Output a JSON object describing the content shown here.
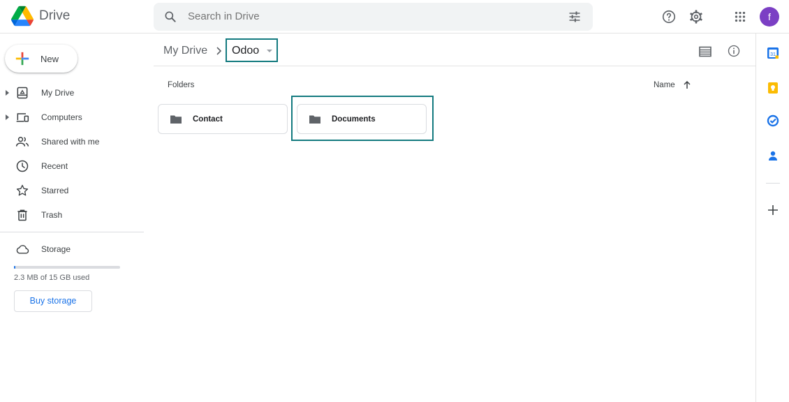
{
  "app": {
    "title": "Drive"
  },
  "search": {
    "placeholder": "Search in Drive"
  },
  "header": {
    "avatar_letter": "f",
    "avatar_color": "#7b3fc4"
  },
  "new_button": {
    "label": "New"
  },
  "sidebar": {
    "items": [
      {
        "label": "My Drive",
        "icon": "my-drive-icon",
        "expandable": true
      },
      {
        "label": "Computers",
        "icon": "computers-icon",
        "expandable": true
      },
      {
        "label": "Shared with me",
        "icon": "shared-with-me-icon",
        "expandable": false
      },
      {
        "label": "Recent",
        "icon": "clock-icon",
        "expandable": false
      },
      {
        "label": "Starred",
        "icon": "star-icon",
        "expandable": false
      },
      {
        "label": "Trash",
        "icon": "trash-icon",
        "expandable": false
      }
    ],
    "storage": {
      "label": "Storage",
      "used_text": "2.3 MB of 15 GB used",
      "used_fraction": 0.0002,
      "buy_label": "Buy storage"
    }
  },
  "breadcrumb": {
    "root": "My Drive",
    "current": "Odoo"
  },
  "main": {
    "section_title": "Folders",
    "sort_label": "Name",
    "folders": [
      {
        "name": "Contact"
      },
      {
        "name": "Documents",
        "highlighted": true
      }
    ]
  },
  "colors": {
    "accent": "#1a73e8",
    "highlight_border": "#137a7f"
  },
  "right_rail": {
    "icons": [
      "calendar-icon",
      "keep-icon",
      "tasks-icon",
      "contacts-icon",
      "add-icon"
    ]
  }
}
